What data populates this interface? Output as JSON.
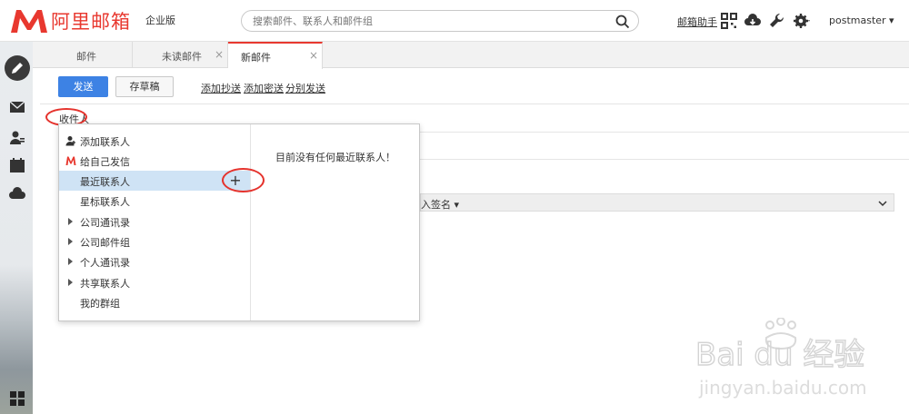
{
  "header": {
    "logo_text": "阿里邮箱",
    "edition": "企业版",
    "search_placeholder": "搜索邮件、联系人和邮件组",
    "mail_helper": "邮箱助手",
    "user": "postmaster ▾"
  },
  "tabs": [
    {
      "label": "邮件"
    },
    {
      "label": "未读邮件",
      "close": "×"
    },
    {
      "label": "新邮件",
      "close": "×"
    }
  ],
  "toolbar": {
    "send": "发送",
    "save_draft": "存草稿",
    "add_cc": "添加抄送",
    "add_bcc": "添加密送",
    "separate_send": "分别发送"
  },
  "compose": {
    "recipient_label": "收件人",
    "signature_label": "入签名 ▾"
  },
  "popup": {
    "items": [
      {
        "label": "添加联系人",
        "icon": "add-contact-icon"
      },
      {
        "label": "给自己发信",
        "icon": "mail-logo-icon"
      },
      {
        "label": "最近联系人",
        "icon": "none"
      },
      {
        "label": "星标联系人",
        "icon": "none"
      },
      {
        "label": "公司通讯录",
        "icon": "caret-right-icon"
      },
      {
        "label": "公司邮件组",
        "icon": "caret-right-icon"
      },
      {
        "label": "个人通讯录",
        "icon": "caret-right-icon"
      },
      {
        "label": "共享联系人",
        "icon": "caret-right-icon"
      },
      {
        "label": "我的群组",
        "icon": "none"
      }
    ],
    "plus": "+",
    "empty_message": "目前没有任何最近联系人！"
  },
  "watermark": {
    "brand": "Bai du 经验",
    "url": "jingyan.baidu.com"
  },
  "colors": {
    "brand_red": "#e8382f",
    "send_blue": "#3d82e4",
    "selected_row": "#cfe3f5",
    "annotation_red": "#e5332d"
  }
}
